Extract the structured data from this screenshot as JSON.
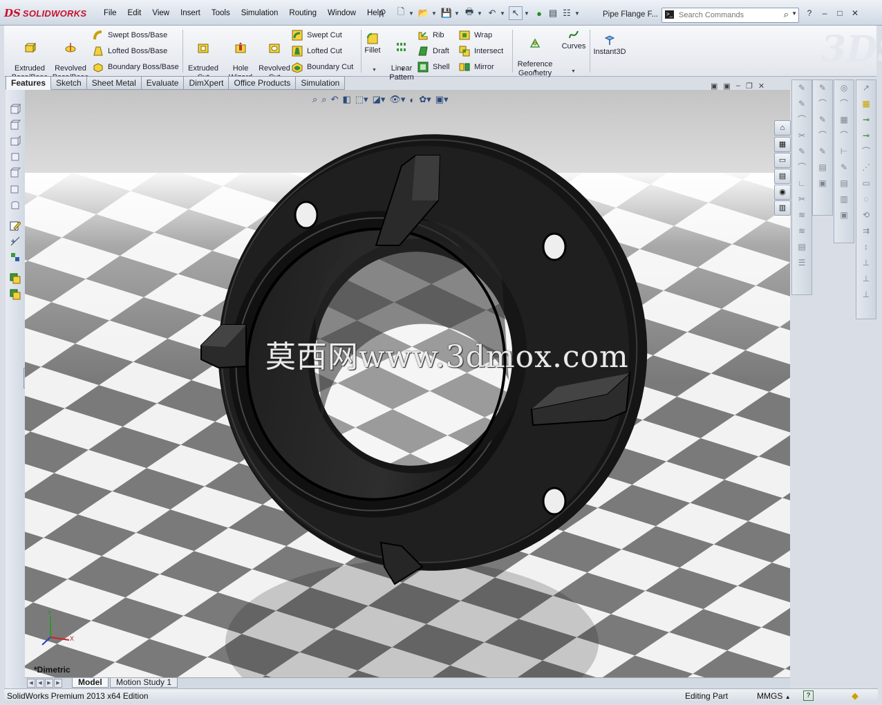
{
  "app": {
    "brand_ds": "DS",
    "brand_name": "SOLIDWORKS"
  },
  "menu": [
    "File",
    "Edit",
    "View",
    "Insert",
    "Tools",
    "Simulation",
    "Routing",
    "Window",
    "Help"
  ],
  "document_title": "Pipe Flange F...",
  "search": {
    "placeholder": "Search Commands"
  },
  "command_manager": {
    "extruded_boss": "Extruded\nBoss/Base",
    "revolved_boss": "Revolved\nBoss/Base",
    "swept_boss": "Swept Boss/Base",
    "lofted_boss": "Lofted Boss/Base",
    "boundary_boss": "Boundary Boss/Base",
    "extruded_cut": "Extruded\nCut",
    "hole_wizard": "Hole\nWizard",
    "revolved_cut": "Revolved\nCut",
    "swept_cut": "Swept Cut",
    "lofted_cut": "Lofted Cut",
    "boundary_cut": "Boundary Cut",
    "fillet": "Fillet",
    "linear_pattern": "Linear\nPattern",
    "rib": "Rib",
    "draft": "Draft",
    "shell": "Shell",
    "wrap": "Wrap",
    "intersect": "Intersect",
    "mirror": "Mirror",
    "reference_geometry": "Reference\nGeometry",
    "curves": "Curves",
    "instant3d": "Instant3D"
  },
  "tabs": [
    "Features",
    "Sketch",
    "Sheet Metal",
    "Evaluate",
    "DimXpert",
    "Office Products",
    "Simulation"
  ],
  "active_tab": "Features",
  "viewport": {
    "view_name": "*Dimetric",
    "watermark": "莫西网www.3dmox.com",
    "triad": {
      "x": "X",
      "y": "Y"
    }
  },
  "model_tabs": [
    "Model",
    "Motion Study 1"
  ],
  "status": {
    "product": "SolidWorks Premium 2013 x64 Edition",
    "mode": "Editing Part",
    "units": "MMGS",
    "help": "?"
  },
  "colors": {
    "brand_red": "#c8102e",
    "part_black": "#1b1b1b"
  }
}
